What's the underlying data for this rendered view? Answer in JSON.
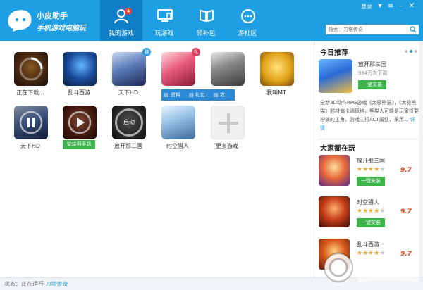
{
  "app": {
    "title": "小皮助手",
    "subtitle": "手机游戏电脑玩"
  },
  "nav": [
    {
      "label": "我的游戏",
      "badge": "4"
    },
    {
      "label": "玩游戏"
    },
    {
      "label": "领补包"
    },
    {
      "label": "游社区"
    }
  ],
  "header": {
    "login": "登录",
    "search_placeholder": "搜索：刀塔传奇"
  },
  "games": [
    {
      "label": "正在下载...",
      "badge": ""
    },
    {
      "label": "乱斗西游",
      "badge": ""
    },
    {
      "label": "天下HD",
      "badge": "装"
    },
    {
      "label": "",
      "badge": "礼"
    },
    {
      "label": "",
      "badge": ""
    },
    {
      "label": "我叫MT",
      "badge": ""
    },
    {
      "label": "天下HD",
      "badge": ""
    },
    {
      "label": "",
      "action": "安装到手机"
    },
    {
      "label": "放开那三国",
      "launch": "启动"
    },
    {
      "label": "时空猎人",
      "badge": ""
    },
    {
      "label": "更多游戏",
      "badge": ""
    }
  ],
  "hover_actions": [
    "资料",
    "礼包",
    "攻略"
  ],
  "sidebar": {
    "recommend_title": "今日推荐",
    "rec_game": "放开那三国",
    "rec_downloads": "984万次下载",
    "install_label": "一键安装",
    "rec_desc": "全新3D动作RPG游戏《太极熊猫》，《太极熊猫》题材偏卡通风格，熊猫人可能是玩家将要扮演的主角，游戏主打ACT属性，采用...",
    "rec_more": "详情",
    "playing_title": "大家都在玩",
    "playing": [
      {
        "name": "放开那三国",
        "stars": 4,
        "score": "9.7"
      },
      {
        "name": "时空猎人",
        "stars": 4,
        "score": "9.7"
      },
      {
        "name": "乱斗西游",
        "stars": 4,
        "score": "9.7"
      }
    ]
  },
  "status": {
    "prefix": "状态：正在运行",
    "running_game": "刀塔传奇"
  },
  "colors": {
    "brand": "#1f9fe3",
    "nav_active": "#0e7fc6",
    "install_green": "#3bb54a",
    "star": "#f5a623",
    "score": "#e8430e"
  }
}
